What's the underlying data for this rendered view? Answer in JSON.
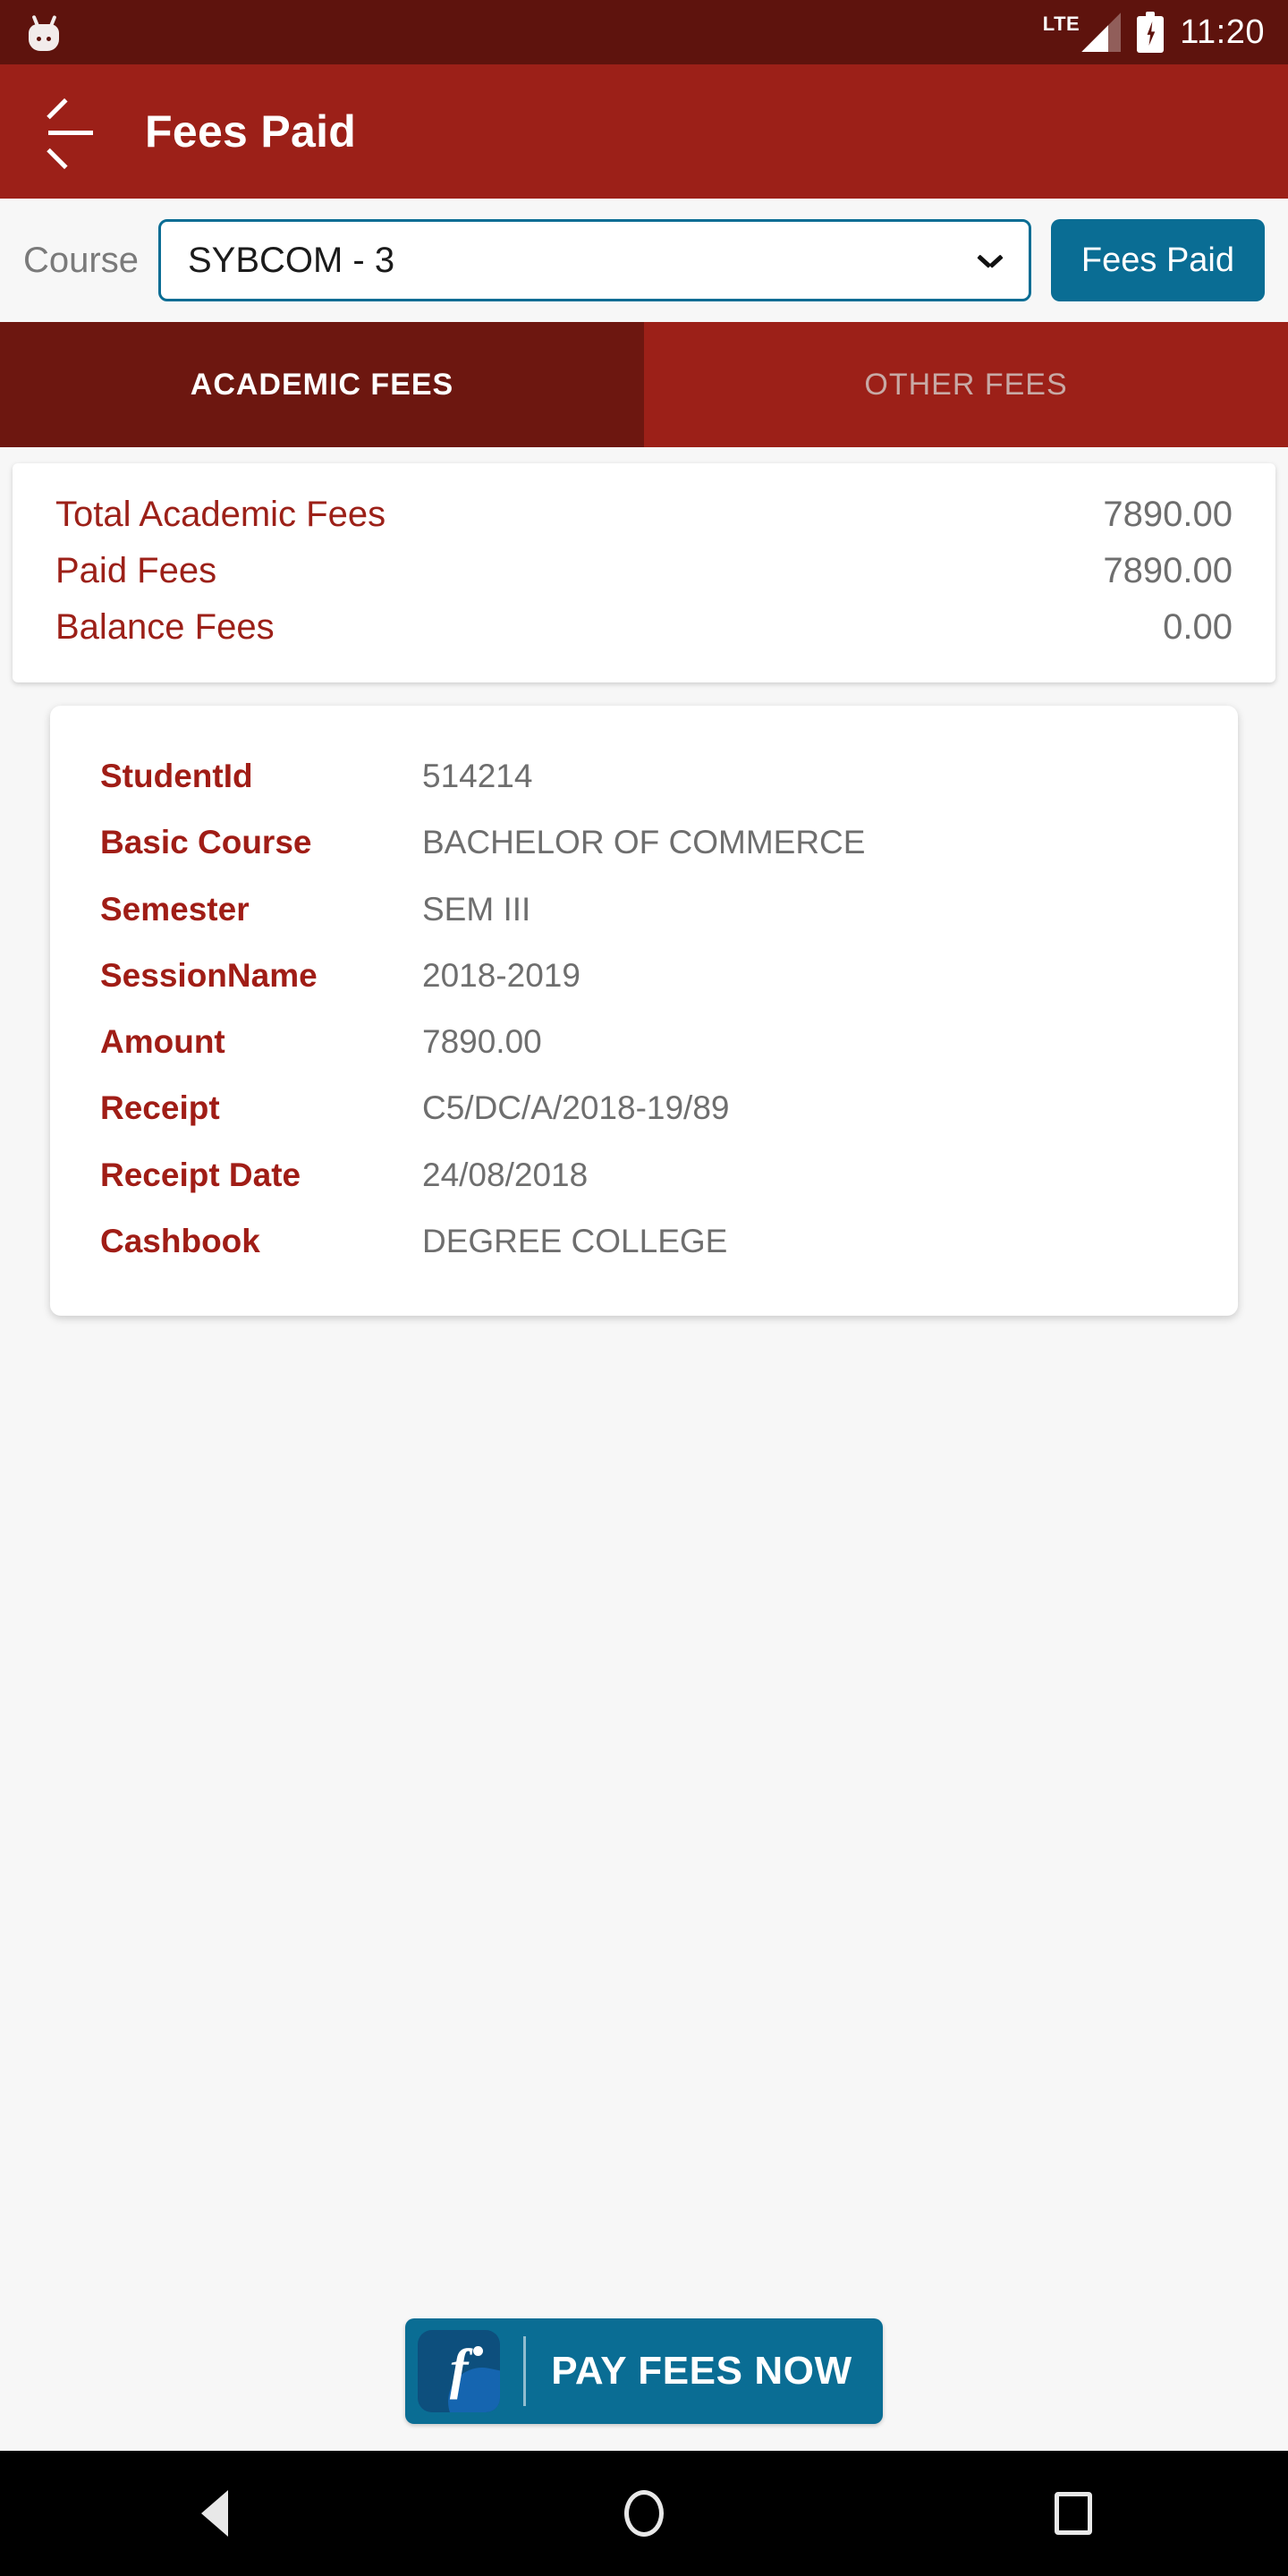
{
  "status_bar": {
    "network_type": "LTE",
    "time": "11:20",
    "icons": [
      "android-mascot-icon",
      "signal-icon",
      "battery-charging-icon"
    ]
  },
  "app_bar": {
    "back_icon": "back-arrow-icon",
    "title": "Fees Paid"
  },
  "selector": {
    "label": "Course",
    "selected_course": "SYBCOM - 3",
    "dropdown_icon": "chevron-down-icon",
    "action_button": "Fees Paid"
  },
  "tabs": [
    {
      "label": "ACADEMIC FEES",
      "active": true
    },
    {
      "label": "OTHER FEES",
      "active": false
    }
  ],
  "summary": [
    {
      "label": "Total Academic Fees",
      "value": "7890.00"
    },
    {
      "label": "Paid Fees",
      "value": "7890.00"
    },
    {
      "label": "Balance Fees",
      "value": "0.00"
    }
  ],
  "details": [
    {
      "label": "StudentId",
      "value": "514214"
    },
    {
      "label": "Basic Course",
      "value": "BACHELOR OF COMMERCE"
    },
    {
      "label": "Semester",
      "value": "SEM III"
    },
    {
      "label": "SessionName",
      "value": "2018-2019"
    },
    {
      "label": "Amount",
      "value": "7890.00"
    },
    {
      "label": "Receipt",
      "value": "C5/DC/A/2018-19/89"
    },
    {
      "label": "Receipt Date",
      "value": "24/08/2018"
    },
    {
      "label": "Cashbook",
      "value": "DEGREE COLLEGE"
    }
  ],
  "pay_button": {
    "label": "PAY FEES NOW",
    "logo_icon": "feepay-logo-icon",
    "logo_glyph": "f"
  },
  "nav_bar": {
    "back_icon": "nav-back-icon",
    "home_icon": "nav-home-icon",
    "recents_icon": "nav-recents-icon"
  },
  "colors": {
    "status_bar": "#5e130d",
    "app_bar": "#9c2018",
    "tab_active": "#6d1710",
    "accent_teal": "#0a6d94",
    "label_red": "#a01d16",
    "value_gray": "#6e6e6e"
  }
}
